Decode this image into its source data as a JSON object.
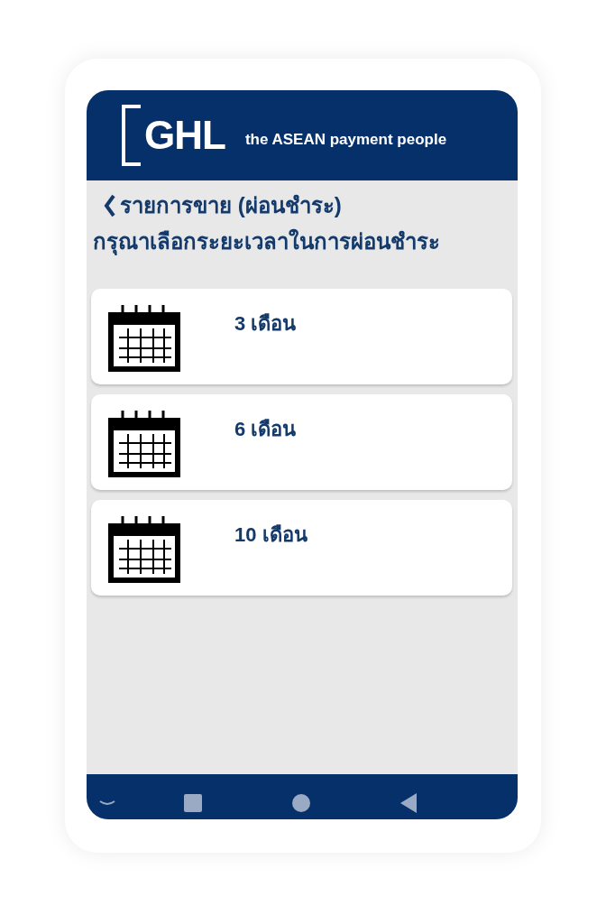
{
  "header": {
    "logo_text": "GHL",
    "tagline": "the ASEAN payment people"
  },
  "page": {
    "back_title": "รายการขาย (ผ่อนชำระ)",
    "subtitle": "กรุณาเลือกระยะเวลาในการผ่อนชำระ"
  },
  "options": [
    {
      "label": "3 เดือน"
    },
    {
      "label": "6 เดือน"
    },
    {
      "label": "10 เดือน"
    }
  ]
}
